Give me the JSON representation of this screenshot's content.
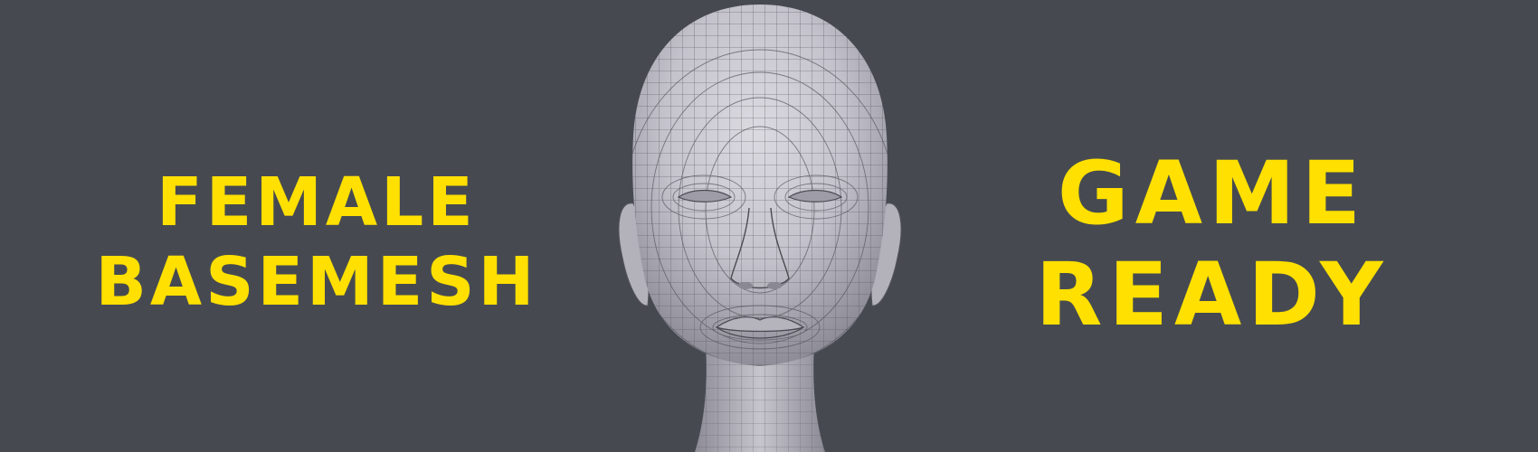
{
  "left_headline": {
    "line1": "FEMALE",
    "line2": "BASEMESH"
  },
  "right_headline": {
    "line1": "GAME",
    "line2": "READY"
  },
  "colors": {
    "background": "#464a50",
    "headline_text": "#ffe000",
    "mesh_surface": "#c9c7cf",
    "wire_lines": "#55555d"
  },
  "render_subject": "head-wireframe-render"
}
